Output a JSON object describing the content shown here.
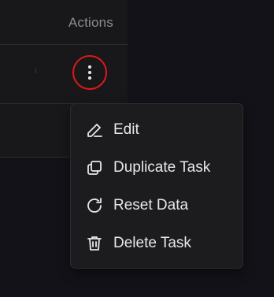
{
  "table": {
    "header": {
      "actions_label": "Actions"
    }
  },
  "menu": {
    "items": [
      {
        "label": "Edit",
        "icon": "pencil-icon"
      },
      {
        "label": "Duplicate Task",
        "icon": "copy-icon"
      },
      {
        "label": "Reset Data",
        "icon": "rotate-cw-icon"
      },
      {
        "label": "Delete Task",
        "icon": "trash-icon"
      }
    ]
  },
  "colors": {
    "background": "#131218",
    "table_bg": "#18181b",
    "menu_bg": "#1c1b1e",
    "highlight_ring": "#e01818",
    "text": "#e8e8ea",
    "header_text": "#8b8b90"
  }
}
